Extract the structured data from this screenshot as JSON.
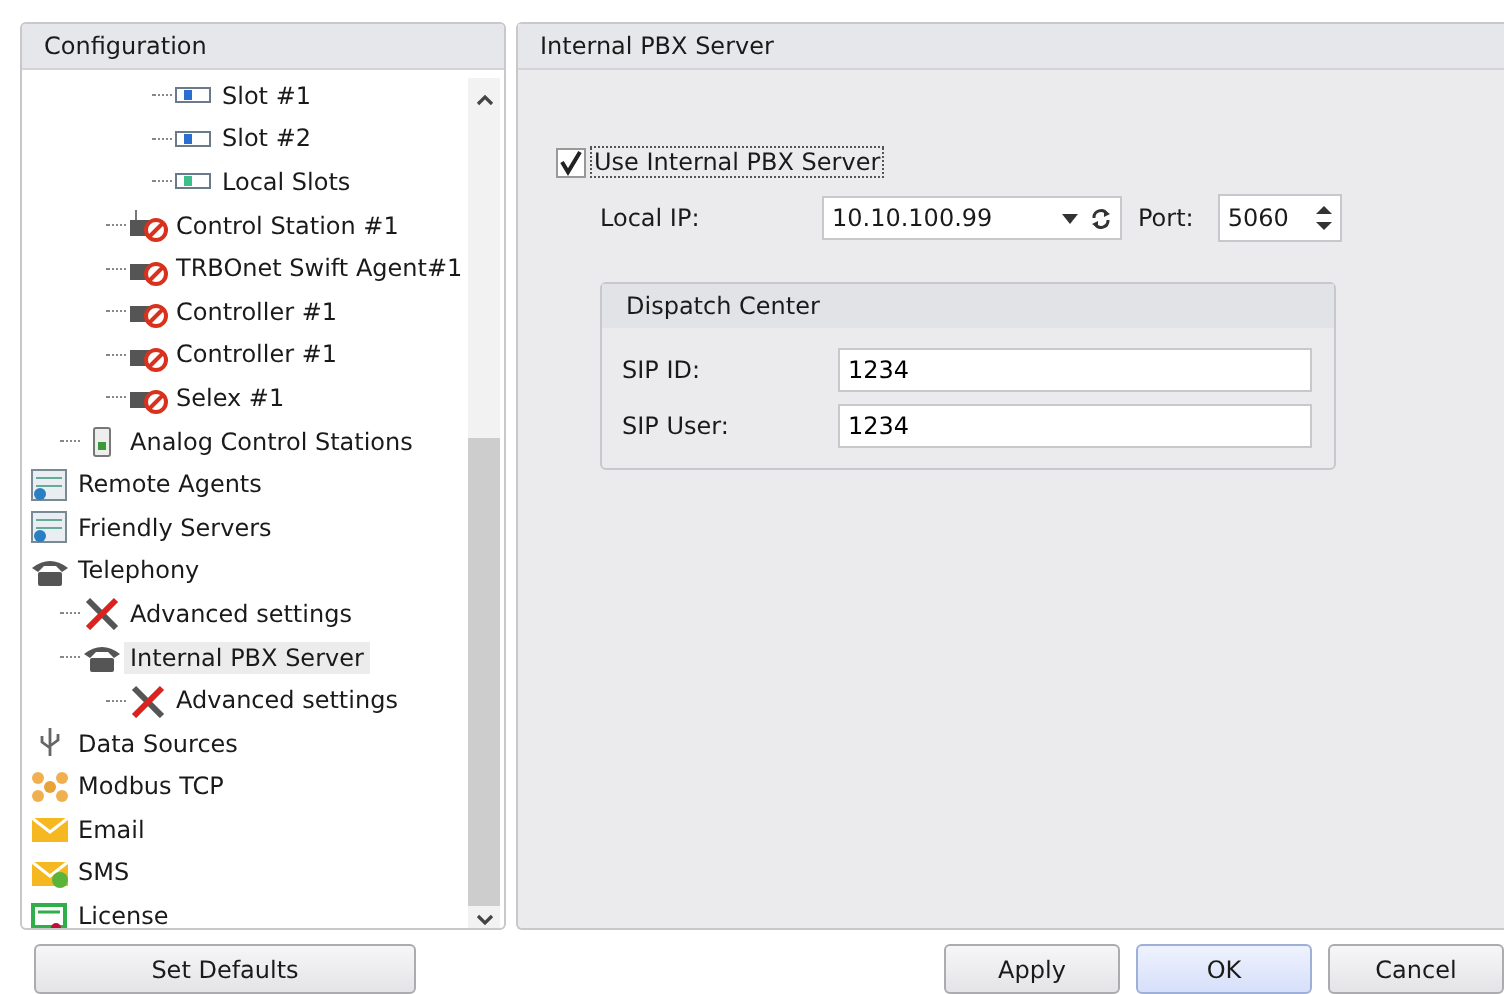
{
  "sidebar": {
    "title": "Configuration",
    "tree": [
      {
        "children": [
          {
            "children": [
              {
                "children": [
                  {
                    "label": "Slot #1",
                    "kind": "slot",
                    "selected": false
                  },
                  {
                    "label": "Slot #2",
                    "kind": "slot",
                    "selected": false
                  },
                  {
                    "label": "Local Slots",
                    "kind": "localslot",
                    "selected": false
                  }
                ]
              },
              {
                "label": "Control Station #1",
                "kind": "station",
                "selected": false
              },
              {
                "label": "TRBOnet Swift Agent#1",
                "kind": "agent",
                "selected": false
              },
              {
                "label": "Controller #1",
                "kind": "controller",
                "selected": false
              },
              {
                "label": "Controller #1",
                "kind": "controller",
                "selected": false
              },
              {
                "label": "Selex #1",
                "kind": "radio",
                "selected": false
              }
            ]
          },
          {
            "label": "Analog Control Stations",
            "kind": "analog",
            "selected": false
          }
        ]
      },
      {
        "label": "Remote Agents",
        "kind": "server",
        "selected": false
      },
      {
        "label": "Friendly Servers",
        "kind": "server",
        "selected": false
      },
      {
        "label": "Telephony",
        "kind": "phone",
        "selected": false,
        "children": [
          {
            "label": "Advanced settings",
            "kind": "tools",
            "selected": false
          },
          {
            "label": "Internal PBX Server",
            "kind": "phone",
            "selected": true,
            "children": [
              {
                "label": "Advanced settings",
                "kind": "tools",
                "selected": false
              }
            ]
          }
        ]
      },
      {
        "label": "Data Sources",
        "kind": "usb",
        "selected": false
      },
      {
        "label": "Modbus TCP",
        "kind": "network",
        "selected": false
      },
      {
        "label": "Email",
        "kind": "email",
        "selected": false
      },
      {
        "label": "SMS",
        "kind": "sms",
        "selected": false
      },
      {
        "label": "License",
        "kind": "license",
        "selected": false
      }
    ],
    "set_defaults_button": "Set Defaults"
  },
  "panel": {
    "title": "Internal PBX Server",
    "use_server": {
      "label": "Use Internal PBX Server",
      "checked": true
    },
    "local_ip": {
      "label": "Local IP:",
      "value": "10.10.100.99"
    },
    "port": {
      "label": "Port:",
      "value": "5060"
    },
    "group": {
      "title": "Dispatch Center",
      "fields": [
        {
          "label": "SIP ID:",
          "value": "1234"
        },
        {
          "label": "SIP User:",
          "value": "1234"
        }
      ]
    }
  },
  "buttons": [
    {
      "label": "Apply",
      "kind": "normal"
    },
    {
      "label": "OK",
      "kind": "default"
    },
    {
      "label": "Cancel",
      "kind": "normal"
    }
  ]
}
